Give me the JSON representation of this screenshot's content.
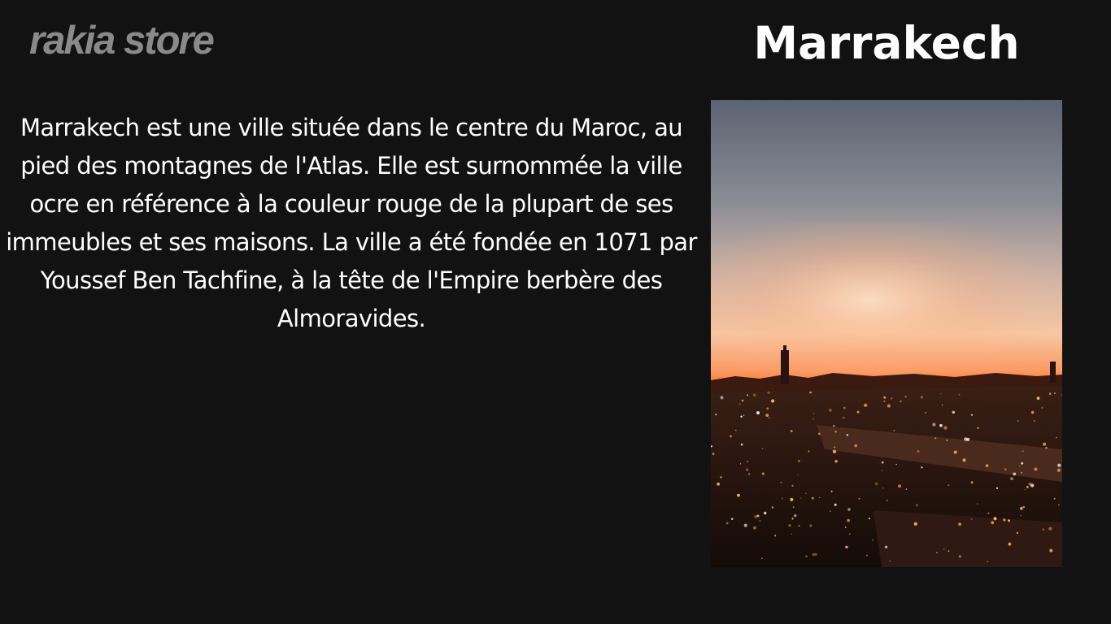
{
  "brand": {
    "name": "rakia store",
    "color": "#8a8a8a"
  },
  "header": {
    "title": "Marrakech",
    "color": "#ffffff"
  },
  "main": {
    "description": "Marrakech est une ville située dans le centre du Maroc, au pied des montagnes de l'Atlas. Elle est surnommée la ville ocre en référence à la couleur rouge de la plupart de ses immeubles et ses maisons. La ville a été fondée en 1071 par Youssef Ben Tachfine, à la tête de l'Empire berbère des Almoravides.",
    "text_color": "#ffffff"
  },
  "photo": {
    "subject": "marrakech-sunset-market-photo",
    "sky_top": "#5b6272",
    "sky_glow": "#f6c7a4",
    "horizon": "#ff6a1f",
    "city_dark": "#24150f",
    "light_color": "#ffb347"
  },
  "colors": {
    "background": "#121212"
  }
}
